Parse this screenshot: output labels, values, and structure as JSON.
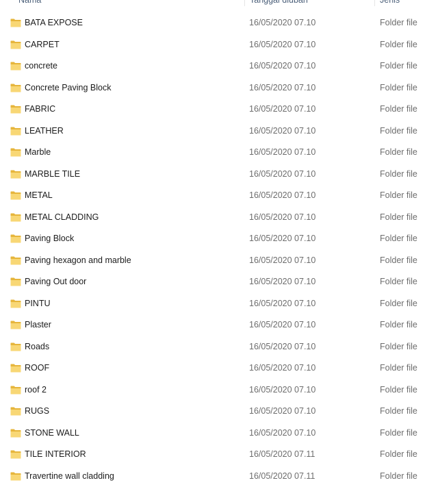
{
  "header": {
    "name_label": "Nama",
    "date_label": "Tanggal diubah",
    "type_label": "Jenis"
  },
  "colors": {
    "folder_front": "#f8d775",
    "folder_back": "#e6b53b",
    "date_text": "#6d6d6d",
    "header_text": "#4c607a"
  },
  "icon": "folder-icon",
  "files": [
    {
      "name": "BATA EXPOSE",
      "date": "16/05/2020 07.10",
      "type": "Folder file"
    },
    {
      "name": "CARPET",
      "date": "16/05/2020 07.10",
      "type": "Folder file"
    },
    {
      "name": "concrete",
      "date": "16/05/2020 07.10",
      "type": "Folder file"
    },
    {
      "name": "Concrete Paving Block",
      "date": "16/05/2020 07.10",
      "type": "Folder file"
    },
    {
      "name": "FABRIC",
      "date": "16/05/2020 07.10",
      "type": "Folder file"
    },
    {
      "name": "LEATHER",
      "date": "16/05/2020 07.10",
      "type": "Folder file"
    },
    {
      "name": "Marble",
      "date": "16/05/2020 07.10",
      "type": "Folder file"
    },
    {
      "name": "MARBLE TILE",
      "date": "16/05/2020 07.10",
      "type": "Folder file"
    },
    {
      "name": "METAL",
      "date": "16/05/2020 07.10",
      "type": "Folder file"
    },
    {
      "name": "METAL CLADDING",
      "date": "16/05/2020 07.10",
      "type": "Folder file"
    },
    {
      "name": "Paving Block",
      "date": "16/05/2020 07.10",
      "type": "Folder file"
    },
    {
      "name": "Paving hexagon and marble",
      "date": "16/05/2020 07.10",
      "type": "Folder file"
    },
    {
      "name": "Paving Out door",
      "date": "16/05/2020 07.10",
      "type": "Folder file"
    },
    {
      "name": "PINTU",
      "date": "16/05/2020 07.10",
      "type": "Folder file"
    },
    {
      "name": "Plaster",
      "date": "16/05/2020 07.10",
      "type": "Folder file"
    },
    {
      "name": "Roads",
      "date": "16/05/2020 07.10",
      "type": "Folder file"
    },
    {
      "name": "ROOF",
      "date": "16/05/2020 07.10",
      "type": "Folder file"
    },
    {
      "name": "roof 2",
      "date": "16/05/2020 07.10",
      "type": "Folder file"
    },
    {
      "name": "RUGS",
      "date": "16/05/2020 07.10",
      "type": "Folder file"
    },
    {
      "name": "STONE WALL",
      "date": "16/05/2020 07.10",
      "type": "Folder file"
    },
    {
      "name": "TILE INTERIOR",
      "date": "16/05/2020 07.11",
      "type": "Folder file"
    },
    {
      "name": "Travertine wall cladding",
      "date": "16/05/2020 07.11",
      "type": "Folder file"
    }
  ]
}
